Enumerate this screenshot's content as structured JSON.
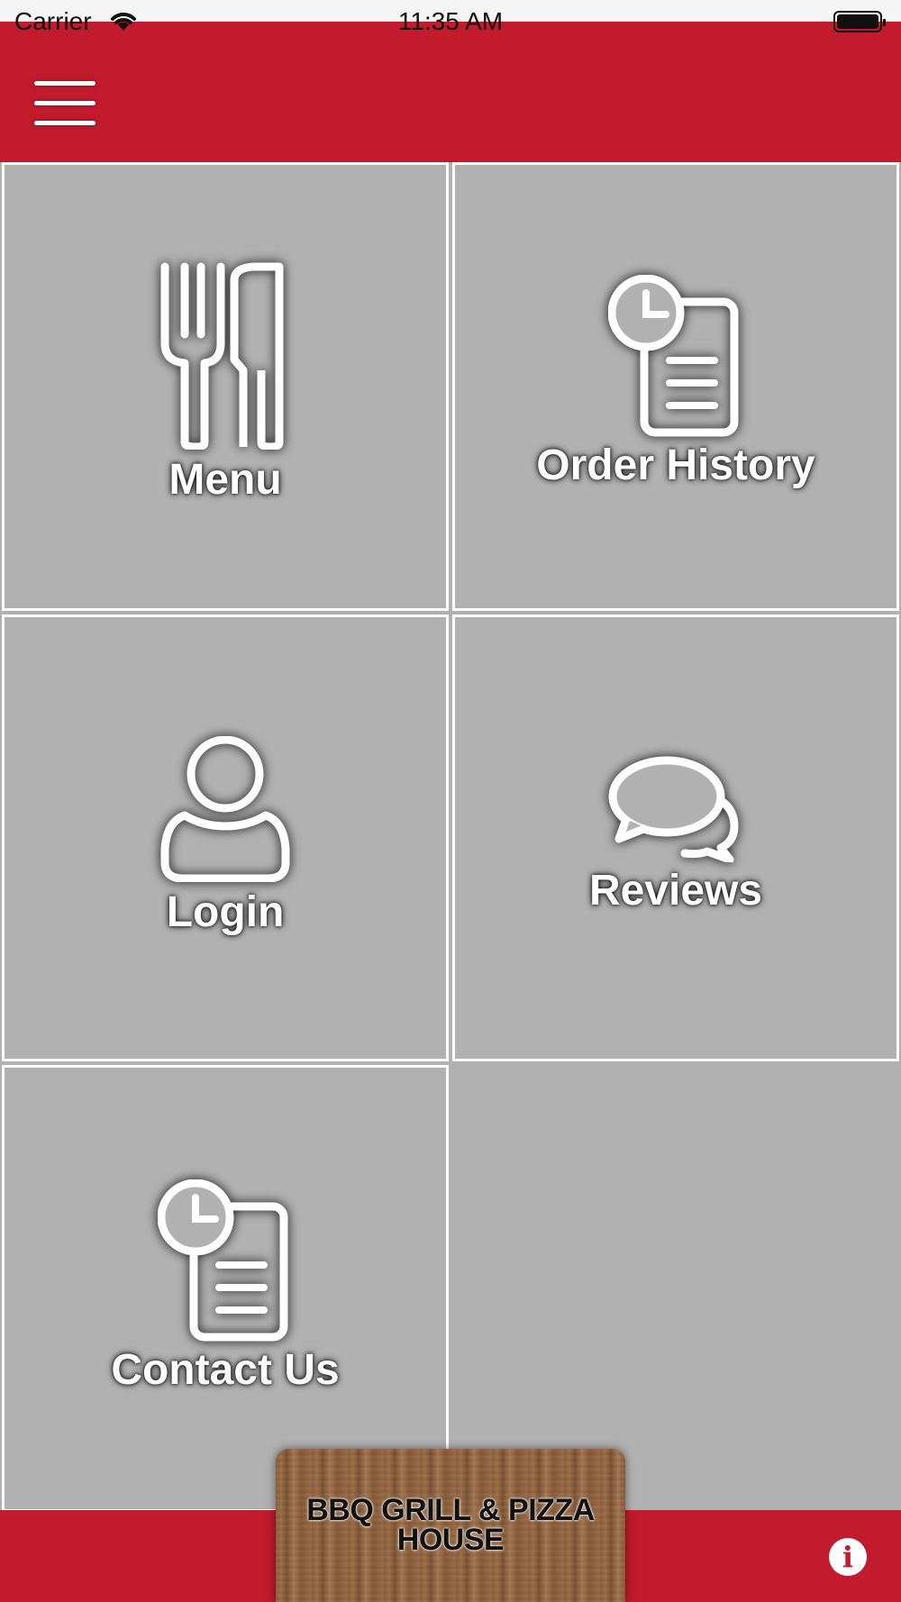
{
  "status_bar": {
    "carrier": "Carrier",
    "time": "11:35 AM",
    "wifi_icon": "wifi-icon",
    "battery_icon": "battery-full-icon"
  },
  "header": {
    "menu_icon": "hamburger-menu-icon",
    "background_color": "#c21b2d"
  },
  "tiles": [
    {
      "label": "Menu",
      "icon": "fork-knife-icon"
    },
    {
      "label": "Order History",
      "icon": "clock-document-icon"
    },
    {
      "label": "Login",
      "icon": "user-icon"
    },
    {
      "label": "Reviews",
      "icon": "chat-bubbles-icon"
    },
    {
      "label": "Contact Us",
      "icon": "clock-document-icon"
    }
  ],
  "footer": {
    "logo_text_line1": "BBQ GRILL & PIZZA",
    "logo_text_line2": "HOUSE",
    "info_icon": "info-icon",
    "background_color": "#c21b2d"
  },
  "colors": {
    "accent": "#c21b2d",
    "tile_background": "#b1b1b1",
    "tile_border": "#ffffff"
  }
}
